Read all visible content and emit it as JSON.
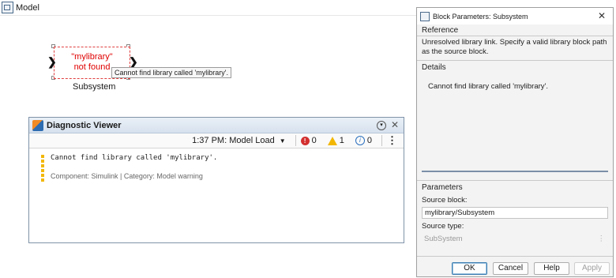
{
  "model": {
    "title": "Model",
    "block": {
      "line1": "\"mylibrary\"",
      "line2": "not found",
      "caption": "Subsystem",
      "tooltip": "Cannot find library called 'mylibrary'."
    }
  },
  "diagnostic_viewer": {
    "title": "Diagnostic Viewer",
    "time_filter": "1:37 PM: Model Load",
    "error_count": "0",
    "warning_count": "1",
    "info_count": "0",
    "message": "Cannot find library called 'mylibrary'.",
    "meta": "Component:  Simulink | Category:  Model warning"
  },
  "block_parameters": {
    "title": "Block Parameters: Subsystem",
    "reference_label": "Reference",
    "reference_text": "Unresolved library link. Specify a valid library block path as the source block.",
    "details_label": "Details",
    "details_text": "Cannot find library called 'mylibrary'.",
    "parameters_label": "Parameters",
    "source_block_label": "Source block:",
    "source_block_value": "mylibrary/Subsystem",
    "source_type_label": "Source type:",
    "source_type_value": "SubSystem",
    "buttons": {
      "ok": "OK",
      "cancel": "Cancel",
      "help": "Help",
      "apply": "Apply"
    }
  }
}
